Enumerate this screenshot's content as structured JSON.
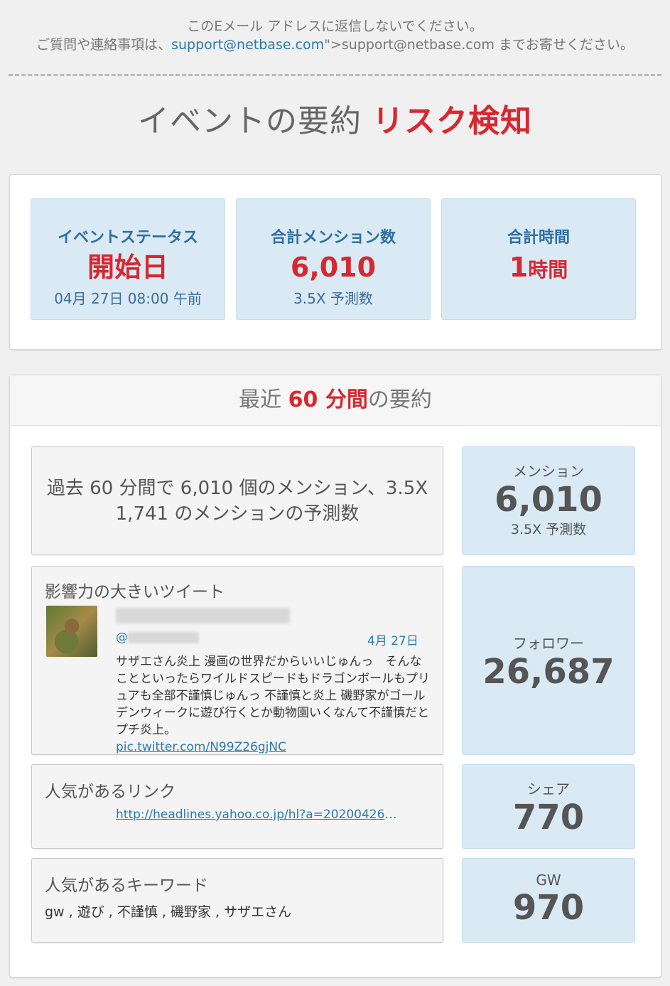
{
  "notice": {
    "line1": "このEメール アドレスに返信しないでください。",
    "line2_prefix": "ご質問や連絡事項は、",
    "email_link": "support@netbase.com",
    "line2_mid": "\">support@netbase.com までお寄せください。"
  },
  "headline": {
    "title": "イベントの要約",
    "accent": "リスク検知"
  },
  "stats": [
    {
      "label": "イベントステータス",
      "value": "開始日",
      "sub": "04月 27日 08:00 午前"
    },
    {
      "label": "合計メンション数",
      "value": "6,010",
      "sub": "3.5X 予測数"
    },
    {
      "label": "合計時間",
      "value_num": "1",
      "value_unit": "時間",
      "sub": ""
    }
  ],
  "recent": {
    "prefix": "最近",
    "accent": "60 分間",
    "suffix": "の要約"
  },
  "summary": {
    "line1": "過去 60 分間で 6,010 個のメンション、3.5X",
    "line2": "1,741 のメンションの予測数"
  },
  "mentions_metric": {
    "label": "メンション",
    "value": "6,010",
    "sub": "3.5X 予測数"
  },
  "tweet": {
    "title": "影響力の大きいツイート",
    "handle_prefix": "@",
    "date": "4月 27日",
    "text": "サザエさん炎上 漫画の世界だからいいじゅんっ　そんなことといったらワイルドスピードもドラゴンボールもプリュアも全部不謹慎じゅんっ 不謹慎と炎上 磯野家がゴールデンウィークに遊び行くとか動物園いくなんて不謹慎だとプチ炎上。",
    "link": "pic.twitter.com/N99Z26gjNC"
  },
  "followers_metric": {
    "label": "フォロワー",
    "value": "26,687"
  },
  "popular_link": {
    "title": "人気があるリンク",
    "url": "http://headlines.yahoo.co.jp/hl?a=20200426-..."
  },
  "shares_metric": {
    "label": "シェア",
    "value": "770"
  },
  "popular_keywords": {
    "title": "人気があるキーワード",
    "list": "gw , 遊び , 不謹慎 , 磯野家 , サザエさん"
  },
  "keyword_metric": {
    "label": "GW",
    "value": "970"
  }
}
